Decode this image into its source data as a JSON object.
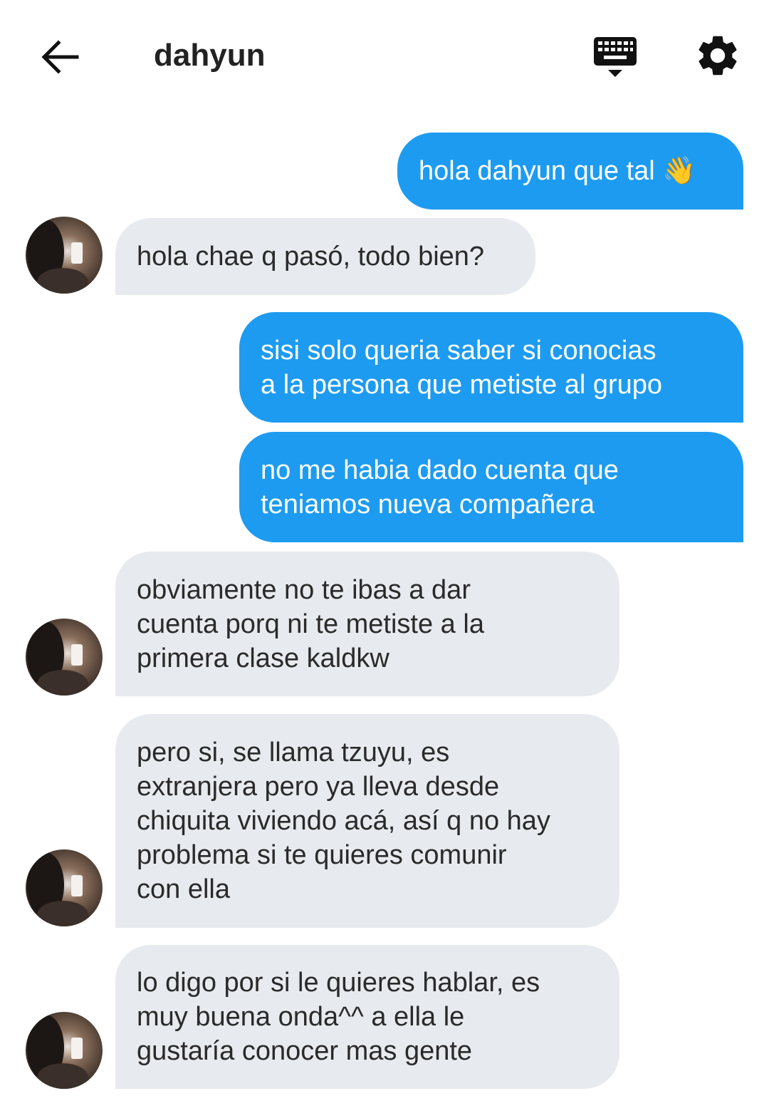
{
  "header": {
    "title": "dahyun",
    "icons": {
      "back": "back-arrow-icon",
      "keyboard": "keyboard-icon",
      "settings": "gear-icon"
    }
  },
  "colors": {
    "sent_bubble": "#1d9bf0",
    "received_bubble": "#e7eaee",
    "sent_text": "#ffffff",
    "received_text": "#2a2a2a"
  },
  "messages": [
    {
      "direction": "sent",
      "lines": [
        "hola dahyun que tal 👋"
      ]
    },
    {
      "direction": "received",
      "lines": [
        "hola chae q pasó, todo bien?"
      ]
    },
    {
      "direction": "sent",
      "lines": [
        "sisi solo queria saber si conocias",
        "a la persona que metiste al grupo"
      ]
    },
    {
      "direction": "sent",
      "lines": [
        "no me habia dado cuenta que",
        "teniamos nueva compañera"
      ]
    },
    {
      "direction": "received",
      "lines": [
        "obviamente no te ibas a dar",
        "cuenta porq ni te metiste a la",
        "primera clase kaldkw"
      ]
    },
    {
      "direction": "received",
      "lines": [
        "pero si, se llama tzuyu, es",
        "extranjera pero ya lleva desde",
        "chiquita viviendo acá, así q no hay",
        "problema si te quieres comunir",
        "con ella"
      ]
    },
    {
      "direction": "received",
      "lines": [
        "lo digo por si le quieres hablar, es",
        "muy buena onda^^ a ella le",
        "gustaría conocer mas gente"
      ]
    }
  ]
}
